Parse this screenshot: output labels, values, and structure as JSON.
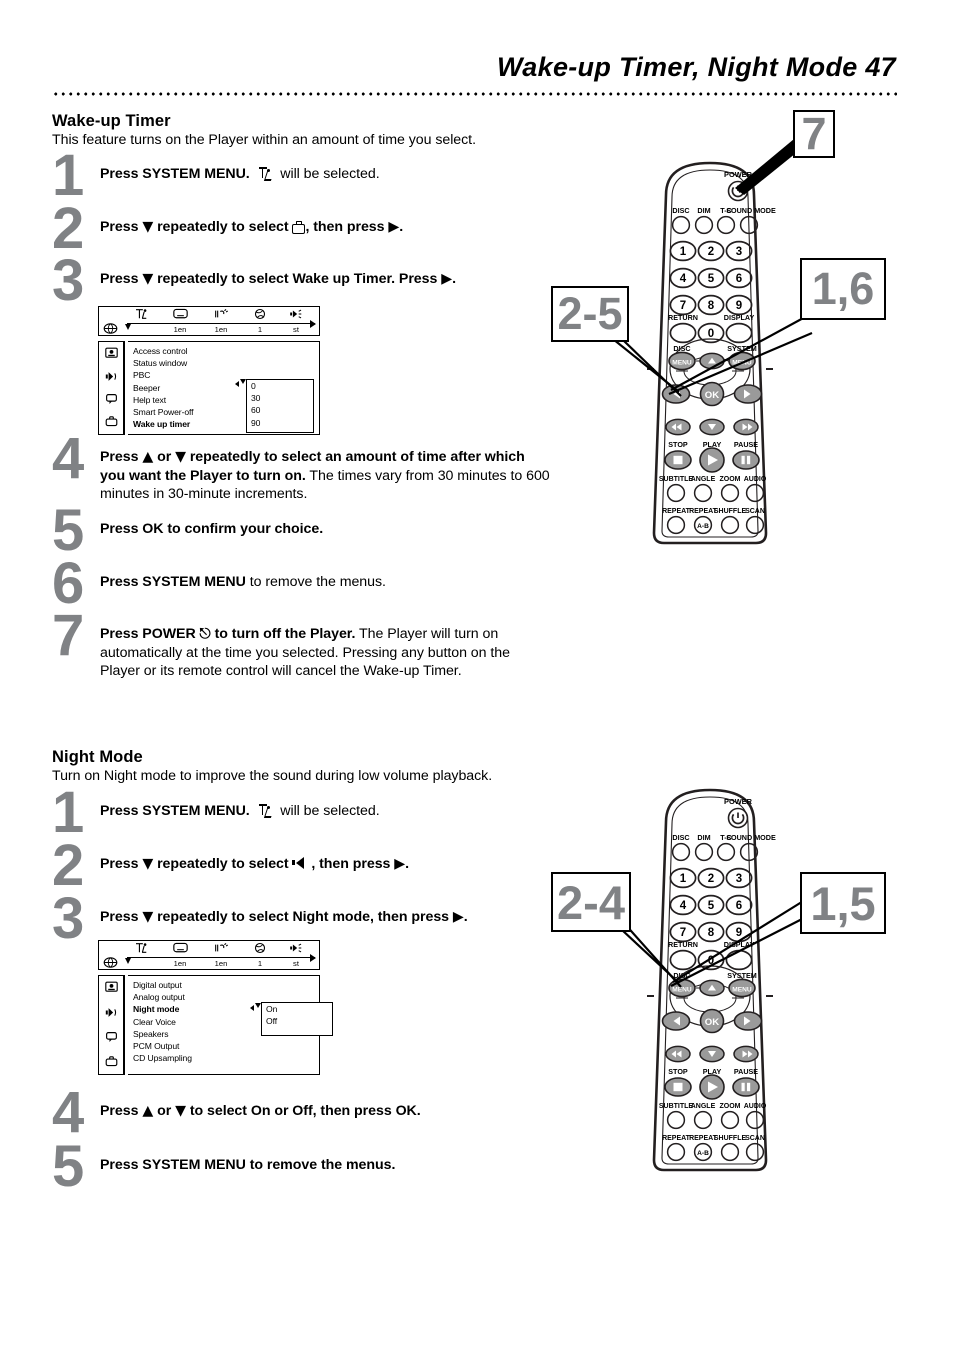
{
  "header": {
    "title": "Wake-up Timer, Night Mode  47"
  },
  "sections": [
    {
      "id": "wake-up-timer",
      "title": "Wake-up Timer",
      "subtitle": "This feature turns on the Player within an amount of time you select.",
      "steps": [
        {
          "num": "1",
          "html": "<b>Press SYSTEM MENU.</b>&nbsp; <span class=\"icon-sysmenu\"><i></i><u></u></span>&nbsp; will be selected."
        },
        {
          "num": "2",
          "html": "<b>Press <span class=\"sym\">&#9660;</span> repeatedly to select <span class=\"icon-prefs\"></span>, then press <span class=\"sym\">&#9654;</span>.</b>"
        },
        {
          "num": "3",
          "html": "<b>Press <span class=\"sym\">&#9660;</span> repeatedly to select Wake up Timer. Press <span class=\"sym\">&#9654;</span>.</b>"
        },
        {
          "num": "4",
          "html": "<b>Press <span class=\"sym\">&#9650;</span> or <span class=\"sym\">&#9660;</span> repeatedly to select an amount of time after which you want the Player to turn on.</b> The times vary from 30 minutes to 600 minutes in 30-minute increments."
        },
        {
          "num": "5",
          "html": "<b>Press OK to confirm your choice.</b>"
        },
        {
          "num": "6",
          "html": "<b>Press SYSTEM MENU</b> to remove the menus."
        },
        {
          "num": "7",
          "html": "<b>Press POWER <span class=\"sym\">&#9099;</span> to turn off the Player.</b> The Player will turn on automatically at the time you selected. Pressing any button on the Player or its remote control will cancel the Wake-up Timer."
        }
      ],
      "osd": {
        "bar_values": [
          "1en",
          "1en",
          "1",
          "st"
        ],
        "sidebar_icons": [
          "picture-icon",
          "sound-icon",
          "features-icon",
          "preferences-icon"
        ],
        "items": [
          {
            "label": "Access control",
            "selected": false
          },
          {
            "label": "Status window",
            "selected": false
          },
          {
            "label": "PBC",
            "selected": false
          },
          {
            "label": "Beeper",
            "selected": false
          },
          {
            "label": "Help text",
            "selected": false
          },
          {
            "label": "Smart Power-off",
            "selected": false
          },
          {
            "label": "Wake up timer",
            "selected": true
          }
        ],
        "popup_values": [
          "0",
          "30",
          "60",
          "90"
        ]
      },
      "callouts": [
        {
          "label": "7"
        },
        {
          "label": "2-5"
        },
        {
          "label": "1,6"
        }
      ]
    },
    {
      "id": "night-mode",
      "title": "Night Mode",
      "subtitle": "Turn on Night mode to improve the sound during low volume playback.",
      "steps": [
        {
          "num": "1",
          "html": "<b>Press SYSTEM MENU.</b>&nbsp; <span class=\"icon-sysmenu\"><i></i><u></u></span>&nbsp; will be selected."
        },
        {
          "num": "2",
          "html": "<b>Press <span class=\"sym\">&#9660;</span> repeatedly to select <span class=\"icon-audio\"></span> , then press <span class=\"sym\">&#9654;</span>.</b>"
        },
        {
          "num": "3",
          "html": "<b>Press <span class=\"sym\">&#9660;</span> repeatedly to select Night mode, then press <span class=\"sym\">&#9654;</span>.</b>"
        },
        {
          "num": "4",
          "html": "<b>Press <span class=\"sym\">&#9650;</span> or <span class=\"sym\">&#9660;</span> to select On or Off, then press OK.</b>"
        },
        {
          "num": "5",
          "html": "<b>Press SYSTEM MENU to remove the menus.</b>"
        }
      ],
      "osd": {
        "bar_values": [
          "1en",
          "1en",
          "1",
          "st"
        ],
        "sidebar_icons": [
          "picture-icon",
          "sound-icon",
          "features-icon",
          "preferences-icon"
        ],
        "items": [
          {
            "label": "Digital output",
            "selected": false
          },
          {
            "label": "Analog output",
            "selected": false
          },
          {
            "label": "Night mode",
            "selected": true
          },
          {
            "label": "Clear Voice",
            "selected": false
          },
          {
            "label": "Speakers",
            "selected": false
          },
          {
            "label": "PCM Output",
            "selected": false
          },
          {
            "label": "CD Upsampling",
            "selected": false
          }
        ],
        "popup_values": [
          "On",
          "Off"
        ]
      },
      "callouts": [
        {
          "label": "2-4"
        },
        {
          "label": "1,5"
        }
      ]
    }
  ],
  "remote": {
    "power_label": "POWER",
    "top_row": [
      "DISC",
      "DIM",
      "T-C",
      "SOUND MODE"
    ],
    "keypad": [
      "1",
      "2",
      "3",
      "4",
      "5",
      "6",
      "7",
      "8",
      "9",
      "0"
    ],
    "return_label": "RETURN",
    "display_label": "DISPLAY",
    "disc_menu_label": "DISC",
    "system_menu_label": "SYSTEM",
    "menu_btn_label": "MENU",
    "ok_label": "OK",
    "transport_labels": [
      "STOP",
      "PLAY",
      "PAUSE"
    ],
    "fn_row1": [
      "SUBTITLE",
      "ANGLE",
      "ZOOM",
      "AUDIO"
    ],
    "fn_row2": [
      "REPEAT",
      "REPEAT",
      "SHUFFLE",
      "SCAN"
    ],
    "ab_label": "A-B"
  },
  "colors": {
    "step_number": "#808285",
    "button_fill": "#9a9a9a",
    "outline": "#231f20"
  }
}
